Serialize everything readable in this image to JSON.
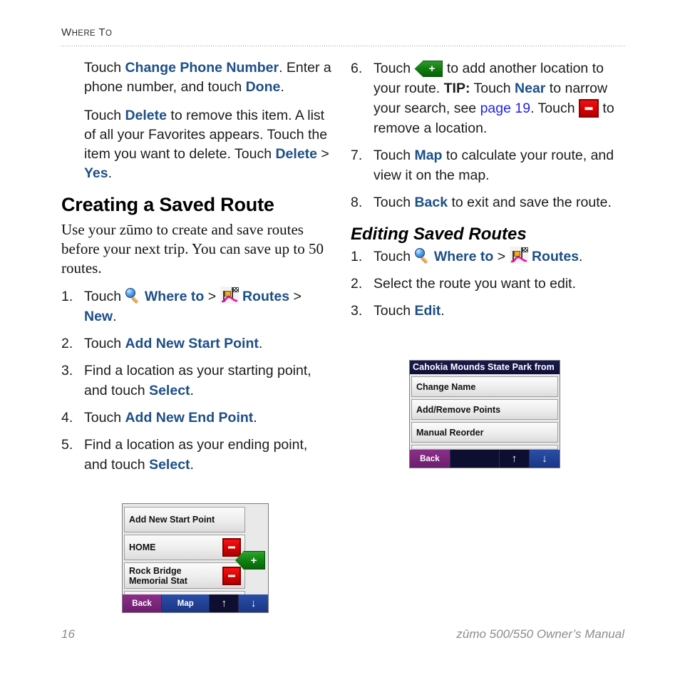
{
  "running_head": {
    "first_letter": "W",
    "rest_a": "HERE",
    "t": "T",
    "rest_b": "O"
  },
  "left_column": {
    "paragraphs": [
      {
        "id": "p1",
        "segments": [
          {
            "t": "Touch ",
            "s": "plain"
          },
          {
            "t": "Change Phone Number",
            "s": "ui"
          },
          {
            "t": ". Enter a phone number, and touch ",
            "s": "plain"
          },
          {
            "t": "Done",
            "s": "ui"
          },
          {
            "t": ".",
            "s": "plain"
          }
        ]
      },
      {
        "id": "p2",
        "segments": [
          {
            "t": "Touch ",
            "s": "plain"
          },
          {
            "t": "Delete",
            "s": "ui"
          },
          {
            "t": " to remove this item. A list of all your Favorites appears. Touch the item you want to delete. Touch ",
            "s": "plain"
          },
          {
            "t": "Delete",
            "s": "ui"
          },
          {
            "t": " > ",
            "s": "plain"
          },
          {
            "t": "Yes",
            "s": "ui"
          },
          {
            "t": ".",
            "s": "plain"
          }
        ]
      }
    ],
    "heading": "Creating a Saved Route",
    "intro": "Use your zūmo to create and save routes before your next trip. You can save up to 50 routes.",
    "steps": [
      {
        "num": "1.",
        "segments": [
          {
            "t": "Touch ",
            "s": "plain"
          },
          {
            "t": "",
            "s": "icon-magnifier"
          },
          {
            "t": " ",
            "s": "plain"
          },
          {
            "t": "Where to",
            "s": "ui"
          },
          {
            "t": " > ",
            "s": "plain"
          },
          {
            "t": "",
            "s": "icon-routes"
          },
          {
            "t": " ",
            "s": "plain"
          },
          {
            "t": "Routes",
            "s": "ui"
          },
          {
            "t": " > ",
            "s": "plain"
          },
          {
            "t": "New",
            "s": "ui"
          },
          {
            "t": ".",
            "s": "plain"
          }
        ]
      },
      {
        "num": "2.",
        "segments": [
          {
            "t": "Touch ",
            "s": "plain"
          },
          {
            "t": "Add New Start Point",
            "s": "ui"
          },
          {
            "t": ".",
            "s": "plain"
          }
        ]
      },
      {
        "num": "3.",
        "segments": [
          {
            "t": "Find a location as your starting point, and touch ",
            "s": "plain"
          },
          {
            "t": "Select",
            "s": "ui"
          },
          {
            "t": ".",
            "s": "plain"
          }
        ]
      },
      {
        "num": "4.",
        "segments": [
          {
            "t": "Touch ",
            "s": "plain"
          },
          {
            "t": "Add New End Point",
            "s": "ui"
          },
          {
            "t": ".",
            "s": "plain"
          }
        ]
      },
      {
        "num": "5.",
        "segments": [
          {
            "t": "Find a location as your ending point, and touch ",
            "s": "plain"
          },
          {
            "t": "Select",
            "s": "ui"
          },
          {
            "t": ".",
            "s": "plain"
          }
        ]
      }
    ]
  },
  "right_column": {
    "steps": [
      {
        "num": "6.",
        "segments": [
          {
            "t": "Touch ",
            "s": "plain"
          },
          {
            "t": "+",
            "s": "btn-plus"
          },
          {
            "t": " to add another location to your route. ",
            "s": "plain"
          },
          {
            "t": "TIP:",
            "s": "tip"
          },
          {
            "t": " Touch ",
            "s": "plain"
          },
          {
            "t": "Near",
            "s": "ui"
          },
          {
            "t": " to narrow your search, see ",
            "s": "plain"
          },
          {
            "t": "page 19",
            "s": "xref"
          },
          {
            "t": ". Touch ",
            "s": "plain"
          },
          {
            "t": "-",
            "s": "btn-minus"
          },
          {
            "t": " to remove a location.",
            "s": "plain"
          }
        ]
      },
      {
        "num": "7.",
        "segments": [
          {
            "t": "Touch ",
            "s": "plain"
          },
          {
            "t": "Map",
            "s": "ui"
          },
          {
            "t": " to calculate your route, and view it on the map.",
            "s": "plain"
          }
        ]
      },
      {
        "num": "8.",
        "segments": [
          {
            "t": "Touch ",
            "s": "plain"
          },
          {
            "t": "Back",
            "s": "ui"
          },
          {
            "t": " to exit and save the route.",
            "s": "plain"
          }
        ]
      }
    ],
    "heading": "Editing Saved Routes",
    "steps2": [
      {
        "num": "1.",
        "segments": [
          {
            "t": "Touch ",
            "s": "plain"
          },
          {
            "t": "",
            "s": "icon-magnifier"
          },
          {
            "t": " ",
            "s": "plain"
          },
          {
            "t": "Where to",
            "s": "ui"
          },
          {
            "t": " > ",
            "s": "plain"
          },
          {
            "t": "",
            "s": "icon-routes"
          },
          {
            "t": " ",
            "s": "plain"
          },
          {
            "t": "Routes",
            "s": "ui"
          },
          {
            "t": ".",
            "s": "plain"
          }
        ]
      },
      {
        "num": "2.",
        "segments": [
          {
            "t": "Select the route you want to edit.",
            "s": "plain"
          }
        ]
      },
      {
        "num": "3.",
        "segments": [
          {
            "t": "Touch ",
            "s": "plain"
          },
          {
            "t": "Edit",
            "s": "ui"
          },
          {
            "t": ".",
            "s": "plain"
          }
        ]
      }
    ]
  },
  "device_left": {
    "rows": [
      {
        "label": "Add New Start Point",
        "minus": false
      },
      {
        "label": "HOME",
        "minus": true
      },
      {
        "label_line1": "Rock Bridge",
        "label_line2": "Memorial Stat",
        "minus": true
      }
    ],
    "plus_label": "+",
    "toolbar": [
      {
        "label": "Back",
        "kind": "back"
      },
      {
        "label": "Map",
        "kind": "map"
      },
      {
        "label": "↑",
        "kind": "up"
      },
      {
        "label": "↓",
        "kind": "down"
      }
    ]
  },
  "device_right": {
    "title": "Cahokia Mounds State Park from",
    "rows": [
      {
        "label": "Change Name"
      },
      {
        "label": "Add/Remove Points"
      },
      {
        "label": "Manual Reorder"
      }
    ],
    "toolbar": [
      {
        "label": "Back",
        "kind": "back"
      },
      {
        "label": "",
        "kind": "blank"
      },
      {
        "label": "↑",
        "kind": "up"
      },
      {
        "label": "↓",
        "kind": "down"
      }
    ]
  },
  "footer": {
    "page_number": "16",
    "manual_title": "zūmo 500/550 Owner’s Manual"
  },
  "colors": {
    "ui_blue": "#1d4f87",
    "link_blue": "#2222ee",
    "red_button": "#d20000",
    "green_button": "#0f800f",
    "titlebar_navy": "#0f1038",
    "back_purple": "#6d1f6d",
    "map_blue": "#1b3684",
    "footer_gray": "#8c8c8c"
  }
}
